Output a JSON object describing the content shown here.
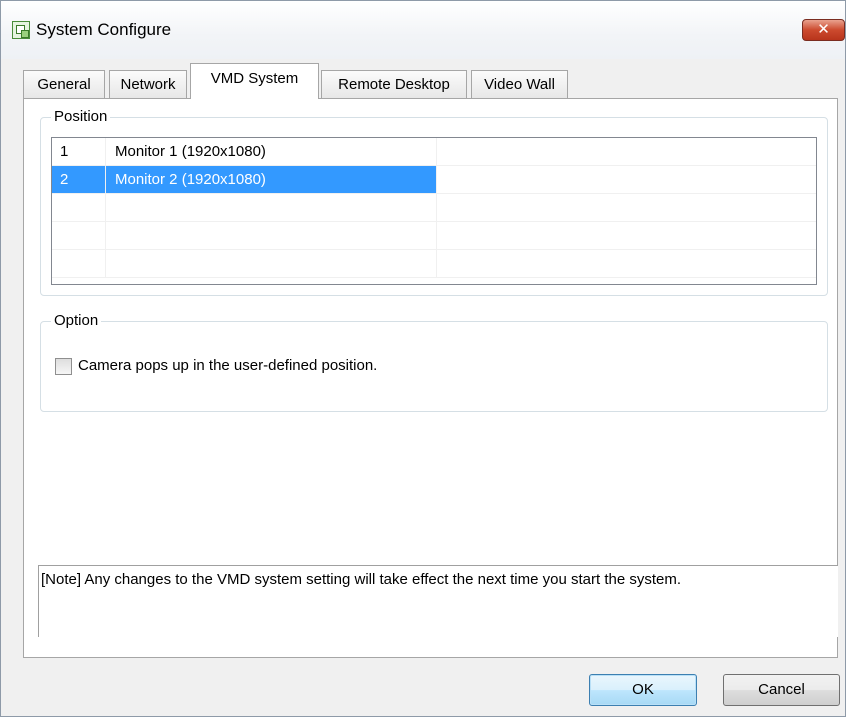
{
  "window": {
    "title": "System Configure",
    "close_label": "✕"
  },
  "tabs": [
    {
      "label": "General",
      "active": false
    },
    {
      "label": "Network",
      "active": false
    },
    {
      "label": "VMD System",
      "active": true
    },
    {
      "label": "Remote Desktop",
      "active": false
    },
    {
      "label": "Video Wall",
      "active": false
    }
  ],
  "position_group": {
    "legend": "Position",
    "rows": [
      {
        "index": "1",
        "monitor": "Monitor 1  (1920x1080)",
        "selected": false
      },
      {
        "index": "2",
        "monitor": "Monitor 2  (1920x1080)",
        "selected": true
      },
      {
        "index": "",
        "monitor": "",
        "selected": false
      },
      {
        "index": "",
        "monitor": "",
        "selected": false
      },
      {
        "index": "",
        "monitor": "",
        "selected": false
      }
    ]
  },
  "option_group": {
    "legend": "Option",
    "checkbox_label": "Camera pops up in the user-defined position.",
    "checked": false
  },
  "note": "[Note] Any changes to the VMD system setting will take effect the next time you start the system.",
  "buttons": {
    "ok": "OK",
    "cancel": "Cancel"
  },
  "colors": {
    "selection": "#3399ff",
    "close_button": "#cc4a2e"
  },
  "icons": {
    "app": "app-window-icon",
    "close": "close-icon"
  }
}
